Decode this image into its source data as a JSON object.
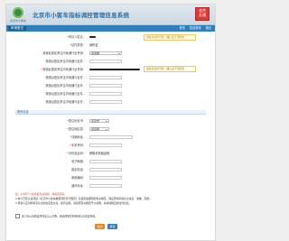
{
  "header": {
    "logo_text": "北京市小客车",
    "title": "北京市小客车指标调控管理信息系统",
    "seal_top": "北京",
    "seal_bottom": "交通"
  },
  "nav": {
    "active_tab": "申请登记",
    "links": [
      "首页",
      "信息查询",
      "退出"
    ]
  },
  "form": {
    "rows": [
      {
        "label": "申请人姓名：",
        "required": true,
        "type": "masked"
      },
      {
        "label": "证件类型：",
        "required": true,
        "type": "text",
        "value": "身份证",
        "tip": "请核对证件号码，确认后不可修改"
      },
      {
        "label": "港澳台居民来往内地通行证号码：",
        "required": false,
        "type": "select",
        "value": "请选择"
      },
      {
        "label": "港澳台居民来往内地通行证件：",
        "required": false,
        "type": "input"
      },
      {
        "label": "港澳台居民来往内地通行证号码：",
        "required": true,
        "type": "masked-wide",
        "tip": "请核对证件号码，确认后不可修改"
      },
      {
        "label": "港澳台居民来往内地通行证件：",
        "required": false,
        "type": "input"
      },
      {
        "label": "港澳台居民来往内地通行证件：",
        "required": false,
        "type": "input"
      },
      {
        "label": "港澳台居民来往内地通行证件：",
        "required": false,
        "type": "input"
      },
      {
        "label": "港澳台居民来往内地通行证件：",
        "required": false,
        "type": "input"
      }
    ],
    "section_title": "联系信息",
    "contact_rows": [
      {
        "label": "居住地省市：",
        "required": true,
        "type": "select",
        "value": "北京市"
      },
      {
        "label": "居住地区县：",
        "required": true,
        "type": "select",
        "value": "请选择"
      },
      {
        "label": "详细地址：",
        "required": true,
        "type": "input"
      },
      {
        "label": "手机号码：",
        "required": true,
        "type": "input"
      },
      {
        "label": "手机验证码：",
        "required": true,
        "type": "text",
        "value": "获取手机验证码"
      },
      {
        "label": "电子邮箱：",
        "required": false,
        "type": "input"
      },
      {
        "label": "固定电话：",
        "required": false,
        "type": "input"
      },
      {
        "label": "邮政编码：",
        "required": false,
        "type": "input"
      },
      {
        "label": "通讯地址：",
        "required": false,
        "type": "input"
      }
    ]
  },
  "notes": {
    "heading": "注：1.标有“*”的项目为必填项，请如实填写。",
    "items": [
      "2.本人已经认真阅读《北京市小客车数量调控暂行规定》及其实施细则的有关规定，保证所填写的信息真实、准确、完整。",
      "3.申请人应对所填写信息的真实性负责，如有虚假，将按照有关规定予以处理，并承担相应的法律责任。"
    ]
  },
  "agree_text": "本人已认真阅读并同意以上声明，承诺所填写的申请信息真实有效。",
  "buttons": {
    "submit": "提交",
    "reset": "重置"
  }
}
